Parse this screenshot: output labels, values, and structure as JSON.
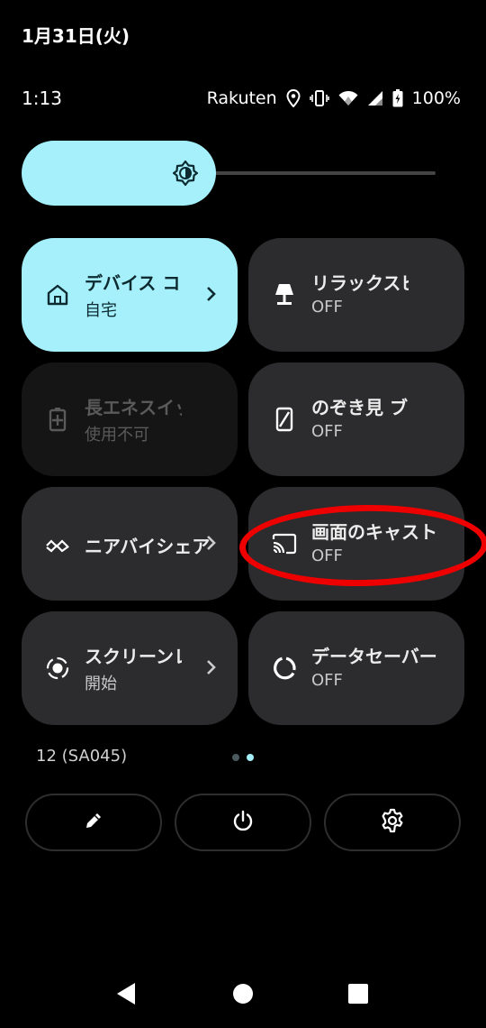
{
  "header": {
    "date": "1月31日(火)"
  },
  "status_bar": {
    "time": "1:13",
    "carrier": "Rakuten",
    "battery_percent": "100%"
  },
  "brightness": {
    "level": 0.47,
    "icon": "brightness-icon"
  },
  "tiles": [
    {
      "label": "デバイス コントロール",
      "sub": "自宅",
      "icon": "home-icon",
      "state": "active",
      "has_chevron": true
    },
    {
      "label": "リラックスビュー",
      "sub": "OFF",
      "icon": "lamp-icon",
      "state": "off",
      "has_chevron": false
    },
    {
      "label": "長エネスイッチ",
      "sub": "使用不可",
      "icon": "battery-plus-icon",
      "state": "disabled",
      "has_chevron": false
    },
    {
      "label": "のぞき見 ブロック",
      "sub": "OFF",
      "icon": "privacy-phone-icon",
      "state": "off",
      "has_chevron": false
    },
    {
      "label": "ニアバイシェア",
      "sub": "",
      "icon": "nearby-share-icon",
      "state": "off",
      "has_chevron": true
    },
    {
      "label": "画面のキャスト",
      "sub": "OFF",
      "icon": "cast-icon",
      "state": "off",
      "has_chevron": false
    },
    {
      "label": "スクリーンレコード",
      "sub": "開始",
      "icon": "screen-record-icon",
      "state": "off",
      "has_chevron": true
    },
    {
      "label": "データセーバー",
      "sub": "OFF",
      "icon": "data-saver-icon",
      "state": "off",
      "has_chevron": false
    }
  ],
  "footer": {
    "build": "12 (SA045)",
    "page_index": 1,
    "page_count": 2
  },
  "bottom_buttons": [
    "edit-icon",
    "power-icon",
    "settings-icon"
  ],
  "nav_buttons": [
    "back-icon",
    "home-icon",
    "recents-icon"
  ],
  "colors": {
    "accent": "#a6f0fc",
    "tile": "#2c2c2e",
    "annotation": "#e00000"
  }
}
